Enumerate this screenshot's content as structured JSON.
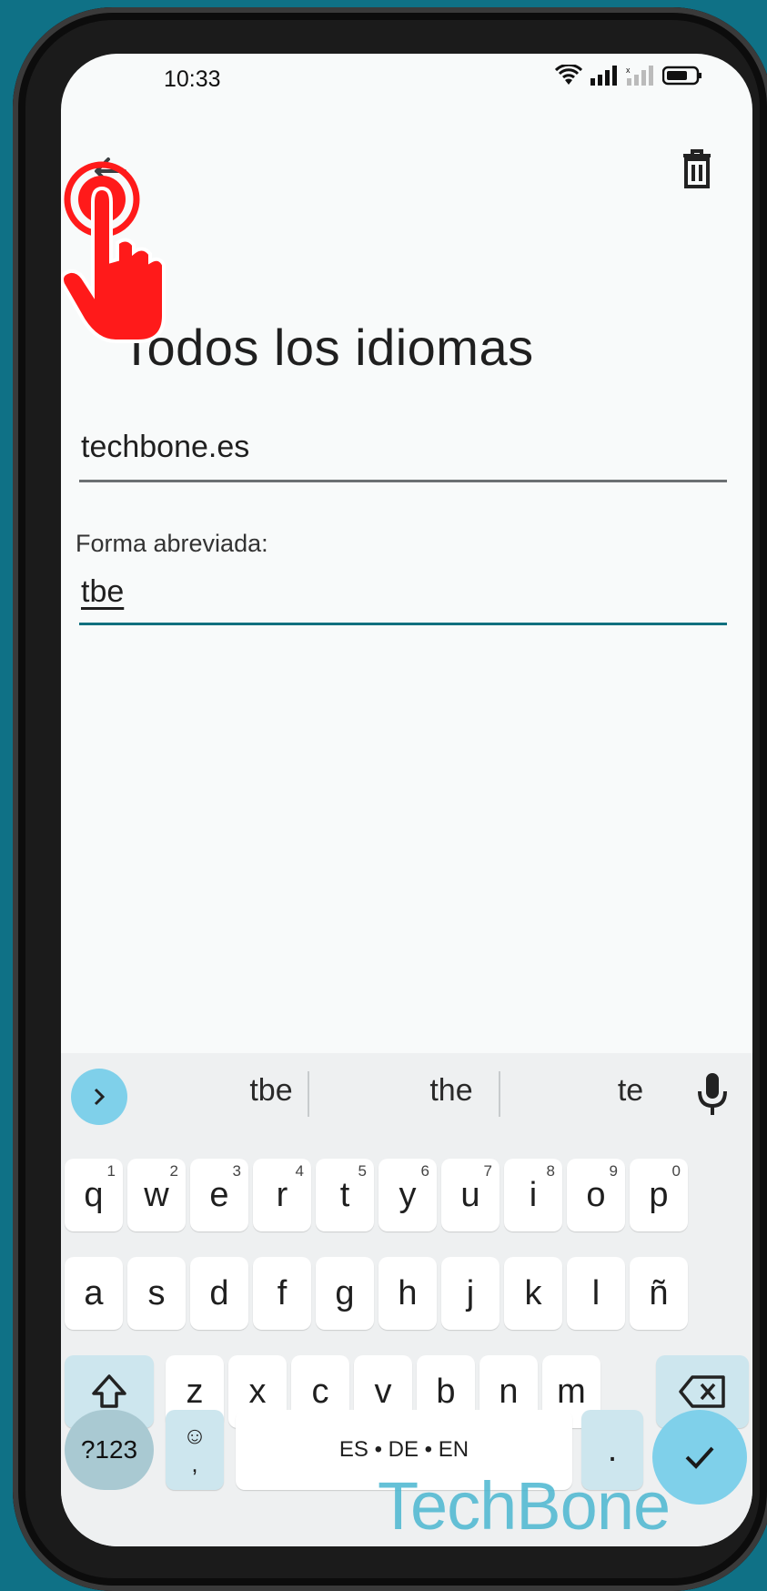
{
  "status": {
    "time": "10:33"
  },
  "page": {
    "title": "Todos los idiomas"
  },
  "entry": {
    "phrase_value": "techbone.es",
    "shortcut_label": "Forma abreviada:",
    "shortcut_value": "tbe"
  },
  "suggestions": [
    "tbe",
    "the",
    "te"
  ],
  "keyboard": {
    "row1": [
      {
        "k": "q",
        "h": "1"
      },
      {
        "k": "w",
        "h": "2"
      },
      {
        "k": "e",
        "h": "3"
      },
      {
        "k": "r",
        "h": "4"
      },
      {
        "k": "t",
        "h": "5"
      },
      {
        "k": "y",
        "h": "6"
      },
      {
        "k": "u",
        "h": "7"
      },
      {
        "k": "i",
        "h": "8"
      },
      {
        "k": "o",
        "h": "9"
      },
      {
        "k": "p",
        "h": "0"
      }
    ],
    "row2": [
      "a",
      "s",
      "d",
      "f",
      "g",
      "h",
      "j",
      "k",
      "l",
      "ñ"
    ],
    "row3": [
      "z",
      "x",
      "c",
      "v",
      "b",
      "n",
      "m"
    ],
    "symbols_label": "?123",
    "emoji_label": "☺",
    "comma_label": ",",
    "space_label": "ES • DE • EN",
    "period_label": "."
  },
  "watermark": "TechBone",
  "colors": {
    "accent": "#11707f",
    "background": "#0f7186",
    "tap_indicator": "#ff1a1a"
  }
}
